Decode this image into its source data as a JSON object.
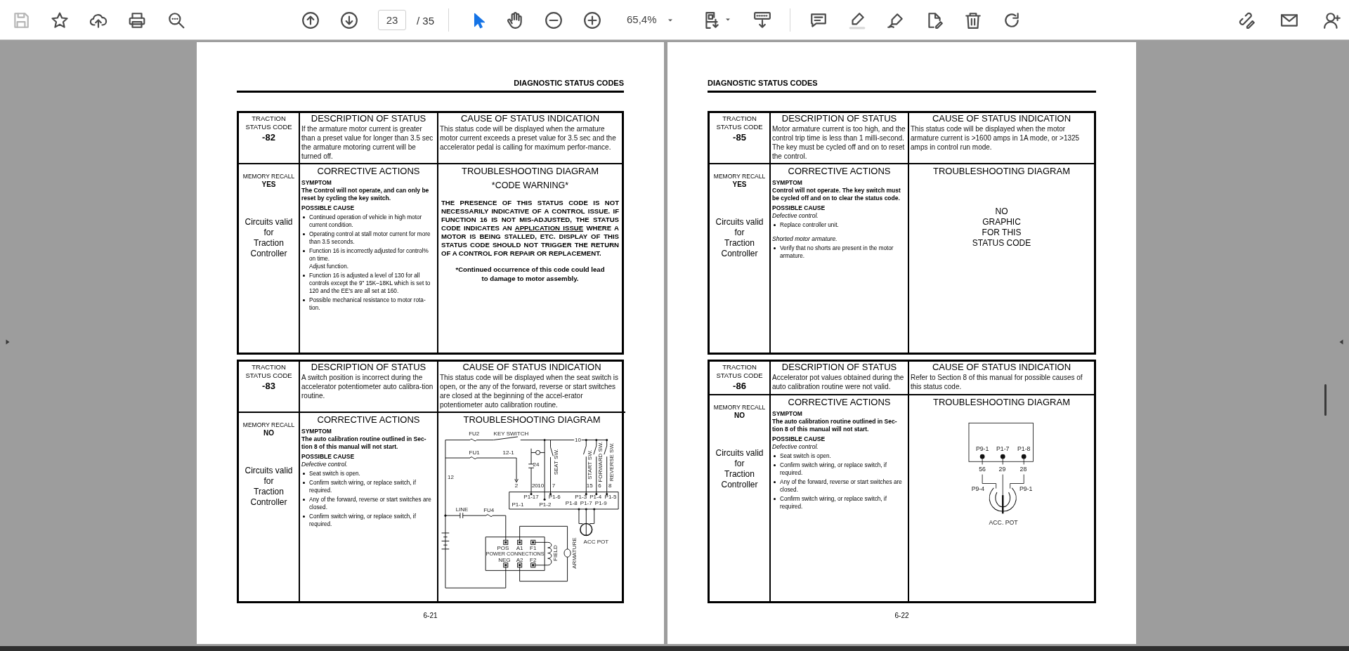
{
  "toolbar": {
    "save": {
      "disabled": true
    },
    "page_current": "23",
    "page_total": "/ 35",
    "zoom": "65,4%"
  },
  "pages": [
    {
      "header": "DIAGNOSTIC STATUS CODES",
      "page_number": "6-21",
      "entries": [
        {
          "code_label": [
            "TRACTION",
            "STATUS CODE"
          ],
          "code": "-82",
          "description_heading": "DESCRIPTION OF STATUS",
          "description": "If the armature motor current is greater than a preset value for longer than 3.5 sec the armature motoring current will be turned off.",
          "cause_heading": "CAUSE OF STATUS INDICATION",
          "cause": "This status code will be displayed when the armature motor current exceeds a preset value for 3.5 sec and the accelerator pedal is calling for maximum perfor-mance.",
          "memory_recall_label": "MEMORY RECALL",
          "memory_recall": "YES",
          "circuits_note": [
            "Circuits valid",
            "for",
            "Traction",
            "Controller"
          ],
          "corrective_heading": "CORRECTIVE ACTIONS",
          "symptom_heading": "SYMPTOM",
          "symptom": "The Control will not operate, and can only be reset by cycling the key switch.",
          "possible_cause_heading": "POSSIBLE CAUSE",
          "causes": [
            {
              "kind": "bullet",
              "text": "Continued operation of vehicle in high motor current condition."
            },
            {
              "kind": "bullet",
              "text": "Operating control at stall motor current for more than 3.5 seconds."
            },
            {
              "kind": "bullet",
              "text": "Function 16 is incorrectly adjusted for control% on time."
            },
            {
              "kind": "indented",
              "text": "Adjust function."
            },
            {
              "kind": "bullet",
              "text": "Function 16 is adjusted a level of 130 for all controls except the 9\" 15K–18KL which is set to 120 and the EE's are all set at 160."
            },
            {
              "kind": "bullet",
              "text": "Possible mechanical resistance to motor rota-tion."
            }
          ],
          "diagram_heading": "TROUBLESHOOTING DIAGRAM",
          "diagram": {
            "kind": "warning",
            "title": "*CODE WARNING*",
            "paragraph": [
              {
                "text": "THE PRESENCE OF THIS STATUS CODE IS NOT NECESSARILY INDICATIVE OF A CONTROL ISSUE. IF FUNCTION 16 IS NOT MIS-ADJUSTED, THE STATUS CODE INDICATES AN ",
                "underline": false
              },
              {
                "text": "APPLICATION ISSUE",
                "underline": true
              },
              {
                "text": " WHERE A MOTOR IS BEING STALLED, ETC. DISPLAY OF THIS STATUS CODE SHOULD NOT TRIGGER THE RETURN OF A CONTROL FOR REPAIR OR REPLACEMENT.",
                "underline": false
              }
            ],
            "note": "*Continued occurrence of this code could lead to damage to motor assembly."
          }
        },
        {
          "code_label": [
            "TRACTION",
            "STATUS CODE"
          ],
          "code": "-83",
          "description_heading": "DESCRIPTION OF STATUS",
          "description": "A switch position is incorrect during the accelerator potentiometer auto calibra-tion routine.",
          "cause_heading": "CAUSE OF STATUS INDICATION",
          "cause": "This status code will be displayed when the seat switch is open, or the any of the forward, reverse or start switches are closed at the beginning of the accel-erator potentiometer auto calibration routine.",
          "memory_recall_label": "MEMORY RECALL",
          "memory_recall": "NO",
          "circuits_note": [
            "Circuits valid",
            "for",
            "Traction",
            "Controller"
          ],
          "corrective_heading": "CORRECTIVE ACTIONS",
          "symptom_heading": "SYMPTOM",
          "symptom": "The auto calibration routine outlined in Sec-tion 8 of this manual will not start.",
          "possible_cause_heading": "POSSIBLE CAUSE",
          "causes": [
            {
              "kind": "italic",
              "text": "Defective control."
            },
            {
              "kind": "bullet",
              "text": "Seat switch is open."
            },
            {
              "kind": "bullet",
              "text": "Confirm switch wiring, or replace switch, if required."
            },
            {
              "kind": "bullet",
              "text": "Any of the forward, reverse or start switches are closed."
            },
            {
              "kind": "bullet",
              "text": "Confirm switch wiring, or replace switch, if required."
            }
          ],
          "diagram_heading": "TROUBLESHOOTING DIAGRAM",
          "diagram": {
            "kind": "circuit",
            "labels": [
              "FU2",
              "KEY SWITCH",
              "10",
              "FU1",
              "12-1",
              "24",
              "SEAT SW.",
              "START SW.",
              "FORWARD SW.",
              "REVERSE SW.",
              "12",
              "2",
              "20",
              "10",
              "7",
              "15",
              "6",
              "8",
              "P1-17",
              "P1-6",
              "P1-3",
              "P1-4",
              "P1-5",
              "P1-1",
              "P1-2",
              "P1-8",
              "P1-7",
              "P1-9",
              "LINE",
              "FU4",
              "ACC POT",
              "POS",
              "A1",
              "F1",
              "POWER CONNECTIONS",
              "NEG",
              "A2",
              "F2",
              "FIELD",
              "ARMATURE"
            ]
          }
        }
      ]
    },
    {
      "header": "DIAGNOSTIC STATUS CODES",
      "page_number": "6-22",
      "entries": [
        {
          "code_label": [
            "TRACTION",
            "STATUS CODE"
          ],
          "code": "-85",
          "description_heading": "DESCRIPTION OF STATUS",
          "description": "Motor armature current is too high, and the control trip time is less than 1 milli-second. The key must be cycled off and on to reset the control.",
          "cause_heading": "CAUSE OF STATUS INDICATION",
          "cause": "This status code will be displayed when the motor armature current is >1600 amps in 1A mode, or >1325 amps in control run mode.",
          "memory_recall_label": "MEMORY RECALL",
          "memory_recall": "YES",
          "circuits_note": [
            "Circuits valid",
            "for",
            "Traction",
            "Controller"
          ],
          "corrective_heading": "CORRECTIVE ACTIONS",
          "symptom_heading": "SYMPTOM",
          "symptom": "Control will not operate. The key switch must be cycled off and on to clear the status code.",
          "possible_cause_heading": "POSSIBLE CAUSE",
          "causes": [
            {
              "kind": "italic",
              "text": "Defective control."
            },
            {
              "kind": "bullet",
              "text": "Replace controller unit."
            },
            {
              "kind": "italic",
              "text": "Shorted motor armature."
            },
            {
              "kind": "bullet",
              "text": "Verify that no shorts are present in the motor armature."
            }
          ],
          "diagram_heading": "TROUBLESHOOTING DIAGRAM",
          "diagram": {
            "kind": "text",
            "lines": [
              "NO",
              "GRAPHIC",
              "FOR THIS",
              "STATUS CODE"
            ]
          }
        },
        {
          "code_label": [
            "TRACTION",
            "STATUS CODE"
          ],
          "code": "-86",
          "description_heading": "DESCRIPTION OF STATUS",
          "description": "Accelerator pot values obtained during the auto calibration routine were not valid.",
          "cause_heading": "CAUSE OF STATUS INDICATION",
          "cause": "Refer to Section 8 of this manual for possible causes of this status code.",
          "memory_recall_label": "MEMORY RECALL",
          "memory_recall": "NO",
          "circuits_note": [
            "Circuits valid",
            "for",
            "Traction",
            "Controller"
          ],
          "corrective_heading": "CORRECTIVE ACTIONS",
          "symptom_heading": "SYMPTOM",
          "symptom": "The auto calibration routine outlined in Sec-tion 8 of this manual will not start.",
          "possible_cause_heading": "POSSIBLE CAUSE",
          "causes": [
            {
              "kind": "italic",
              "text": "Defective control."
            },
            {
              "kind": "bullet",
              "text": "Seat switch is open."
            },
            {
              "kind": "bullet",
              "text": "Confirm switch wiring, or replace switch, if required."
            },
            {
              "kind": "bullet",
              "text": "Any of the forward, reverse or start switches are closed."
            },
            {
              "kind": "bullet",
              "text": "Confirm switch wiring, or replace switch, if required."
            }
          ],
          "diagram_heading": "TROUBLESHOOTING DIAGRAM",
          "diagram": {
            "kind": "pot",
            "labels": [
              "P9-1",
              "P1-7",
              "P1-8",
              "56",
              "29",
              "28",
              "P9-4",
              "P9-1",
              "ACC. POT"
            ]
          }
        }
      ]
    }
  ]
}
